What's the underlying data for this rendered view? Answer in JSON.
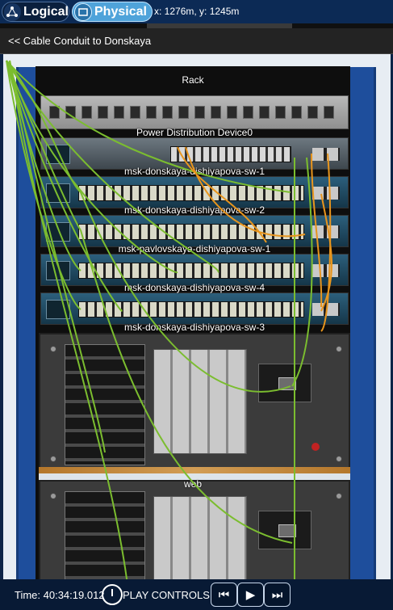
{
  "tabs": {
    "logical": "Logical",
    "physical": "Physical"
  },
  "coords": "x: 1276m, y: 1245m",
  "breadcrumb": "<< Cable Conduit to Donskaya",
  "rack": {
    "title": "Rack",
    "pdu_label": "Power Distribution Device0",
    "switches": [
      "msk-donskaya-dishiyapova-sw-1",
      "msk-donskaya-dishiyapova-sw-2",
      "msk-pavlovskaya-dishiyapova-sw-1",
      "msk-donskaya-dishiyapova-sw-4",
      "msk-donskaya-dishiyapova-sw-3"
    ],
    "server2_label": "web"
  },
  "bottom": {
    "time_label": "Time: 40:34:19.012",
    "play_label": "PLAY CONTROLS:",
    "icons": [
      "back-icon",
      "play-icon",
      "forward-icon"
    ]
  },
  "colors": {
    "cable_green": "#7bbd2f",
    "cable_orange": "#e8951d",
    "rack_blue": "#1e4e9c"
  }
}
